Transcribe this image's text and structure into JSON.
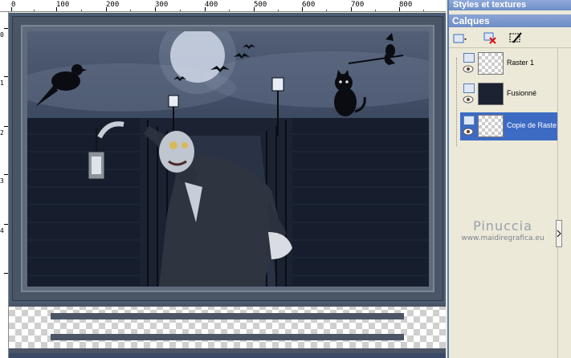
{
  "ruler": {
    "labels": [
      "0",
      "100",
      "200",
      "300",
      "400",
      "500",
      "600",
      "700",
      "800"
    ],
    "left_labels": [
      "0",
      "1",
      "2",
      "3",
      "4"
    ]
  },
  "palette": {
    "styles_title": "Styles et textures",
    "layers_title": "Calques",
    "layers": [
      {
        "name": "Raster 1",
        "selected": false
      },
      {
        "name": "Fusionné",
        "selected": false
      },
      {
        "name": "Copie de Raster",
        "selected": true
      }
    ],
    "watermark": {
      "name": "Pinuccia",
      "url": "www.maidiregrafica.eu"
    }
  },
  "colors": {
    "titlebar": "#6e8fc7",
    "selection": "#3d6bc4",
    "panel_bg": "#ece9d8",
    "canvas_bg": "#4b5d74"
  }
}
